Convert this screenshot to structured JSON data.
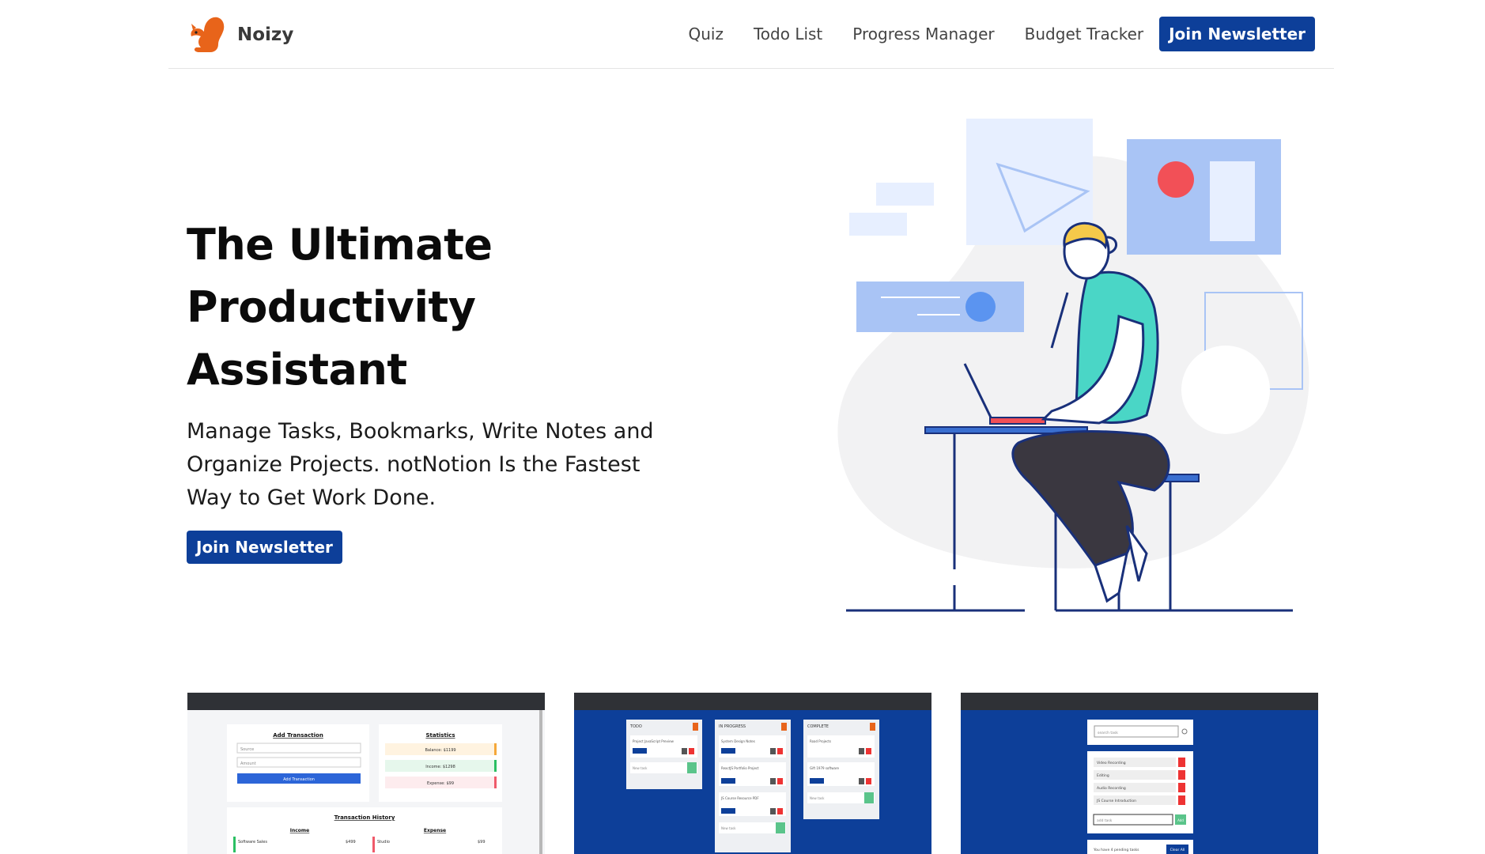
{
  "header": {
    "brand": "Noizy",
    "nav": {
      "quiz": "Quiz",
      "todo": "Todo List",
      "progress": "Progress Manager",
      "budget": "Budget Tracker",
      "join": "Join Newsletter"
    }
  },
  "hero": {
    "title_line1": "The Ultimate",
    "title_line2": "Productivity Assistant",
    "subtitle": "Manage Tasks, Bookmarks, Write Notes and Organize Projects. notNotion Is the Fastest Way to Get Work Done.",
    "cta": "Join Newsletter"
  },
  "colors": {
    "primary": "#0d3f99",
    "brand_orange": "#e8641a",
    "illustration_blue": "#a9c4f5",
    "illustration_teal": "#4ad6c6",
    "accent_red": "#f25057"
  },
  "shots": {
    "budget": {
      "add_title": "Add Transaction",
      "source_placeholder": "Source",
      "amount_placeholder": "Amount",
      "add_button": "Add Transaction",
      "stats_title": "Statistics",
      "balance": "Balance: $1199",
      "income": "Income: $1298",
      "expense": "Expense: $99",
      "history_title": "Transaction History",
      "income_header": "Income",
      "expense_header": "Expense",
      "income_item": "Software Sales",
      "income_amount": "$499",
      "expense_item": "Studio",
      "expense_amount": "$99"
    },
    "progress": {
      "col_todo": "TODO",
      "col_progress": "IN PROGRESS",
      "col_complete": "COMPLETE",
      "todo_task": "Project JavaScript Preview",
      "progress_task_1": "System Design Notes",
      "progress_task_2": "ReactJS Portfolio Project",
      "progress_task_3": "JS Course Resource PDF",
      "complete_task_1": "Road Projects",
      "complete_task_2": "Gift 1979 software",
      "new_task": "New task"
    },
    "todo": {
      "search_placeholder": "search task",
      "task_1": "Video Recording",
      "task_2": "Editing",
      "task_3": "Audio Recording",
      "task_4": "JS Course Introduction",
      "add_placeholder": "add task",
      "add_button": "Add",
      "pending": "You have 4 pending tasks",
      "clear_button": "Clear All"
    }
  }
}
